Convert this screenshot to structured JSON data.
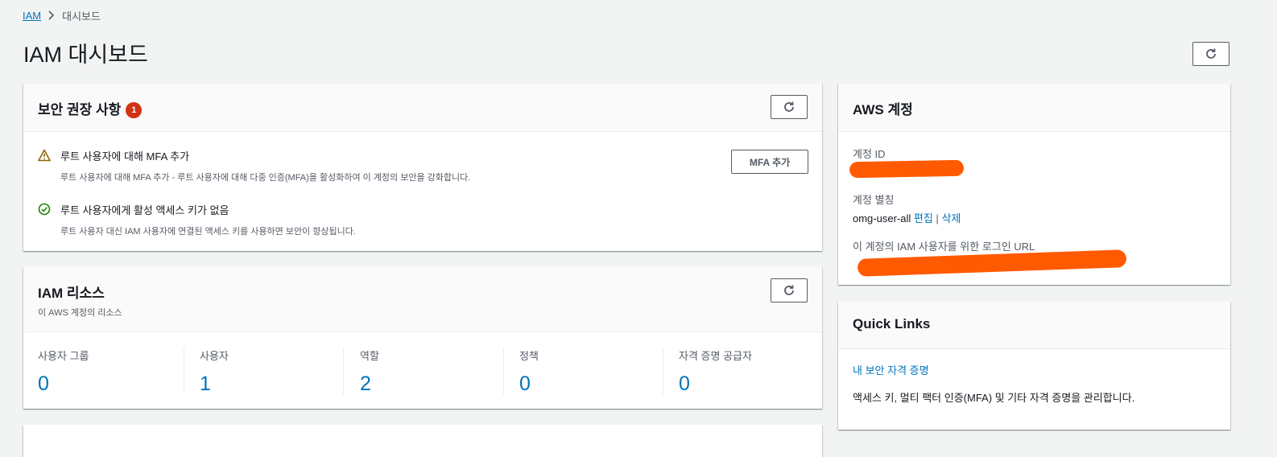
{
  "breadcrumb": {
    "root": "IAM",
    "current": "대시보드"
  },
  "page": {
    "title": "IAM 대시보드"
  },
  "security": {
    "title": "보안 권장 사항",
    "badge": "1",
    "items": [
      {
        "icon": "warning-icon",
        "title": "루트 사용자에 대해 MFA 추가",
        "desc": "루트 사용자에 대해 MFA 추가 - 루트 사용자에 대해 다중 인증(MFA)을 활성화하여 이 계정의 보안을 강화합니다."
      },
      {
        "icon": "check-circle-icon",
        "title": "루트 사용자에게 활성 액세스 키가 없음",
        "desc": "루트 사용자 대신 IAM 사용자에 연결된 액세스 키를 사용하면 보안이 향상됩니다."
      }
    ],
    "mfa_button": "MFA 추가"
  },
  "resources": {
    "title": "IAM 리소스",
    "subtitle": "이 AWS 계정의 리소스",
    "items": [
      {
        "label": "사용자 그룹",
        "value": "0"
      },
      {
        "label": "사용자",
        "value": "1"
      },
      {
        "label": "역할",
        "value": "2"
      },
      {
        "label": "정책",
        "value": "0"
      },
      {
        "label": "자격 증명 공급자",
        "value": "0"
      }
    ]
  },
  "account": {
    "title": "AWS 계정",
    "id_label": "계정 ID",
    "alias_label": "계정 별칭",
    "alias_value": "omg-user-all",
    "edit_link": "편집",
    "separator": "|",
    "delete_link": "삭제",
    "login_url_label": "이 계정의 IAM 사용자를 위한 로그인 URL"
  },
  "quick_links": {
    "title": "Quick Links",
    "link": "내 보안 자격 증명",
    "desc": "액세스 키, 멀티 팩터 인증(MFA) 및 기타 자격 증명을 관리합니다."
  },
  "colors": {
    "link": "#0073bb",
    "badge": "#d13212",
    "warning": "#8d6605",
    "success": "#1d8102",
    "redaction": "#ff5a00"
  }
}
